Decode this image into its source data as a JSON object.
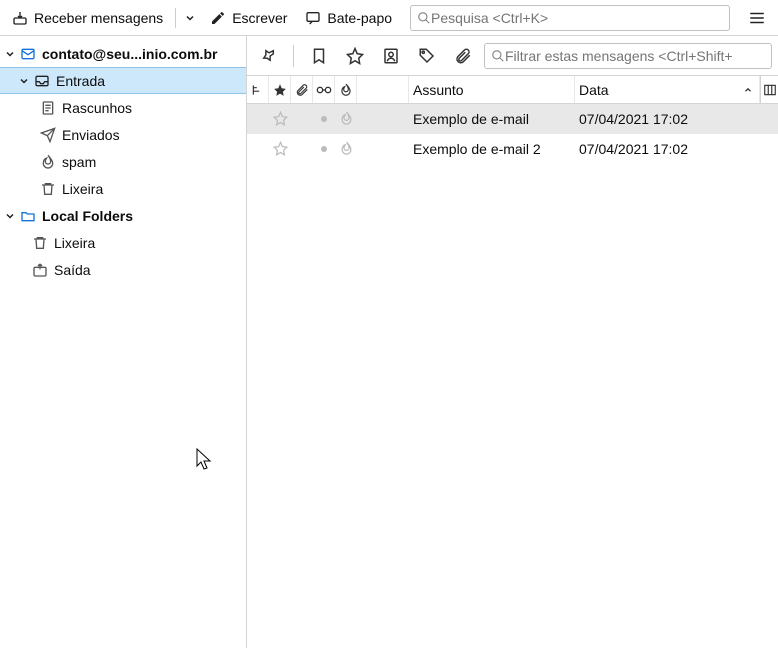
{
  "toolbar": {
    "get": "Receber mensagens",
    "write": "Escrever",
    "chat": "Bate-papo",
    "search_placeholder": "Pesquisa <Ctrl+K>"
  },
  "accounts": {
    "email": "contato@seu...inio.com.br",
    "folders": {
      "inbox": "Entrada",
      "drafts": "Rascunhos",
      "sent": "Enviados",
      "spam": "spam",
      "trash": "Lixeira"
    },
    "local": {
      "name": "Local Folders",
      "trash": "Lixeira",
      "outbox": "Saída"
    }
  },
  "filter": {
    "placeholder": "Filtrar estas mensagens <Ctrl+Shift+"
  },
  "columns": {
    "subject": "Assunto",
    "date": "Data"
  },
  "messages": [
    {
      "subject": "Exemplo de e-mail",
      "date": "07/04/2021 17:02",
      "selected": true
    },
    {
      "subject": "Exemplo de e-mail 2",
      "date": "07/04/2021 17:02",
      "selected": false
    }
  ]
}
